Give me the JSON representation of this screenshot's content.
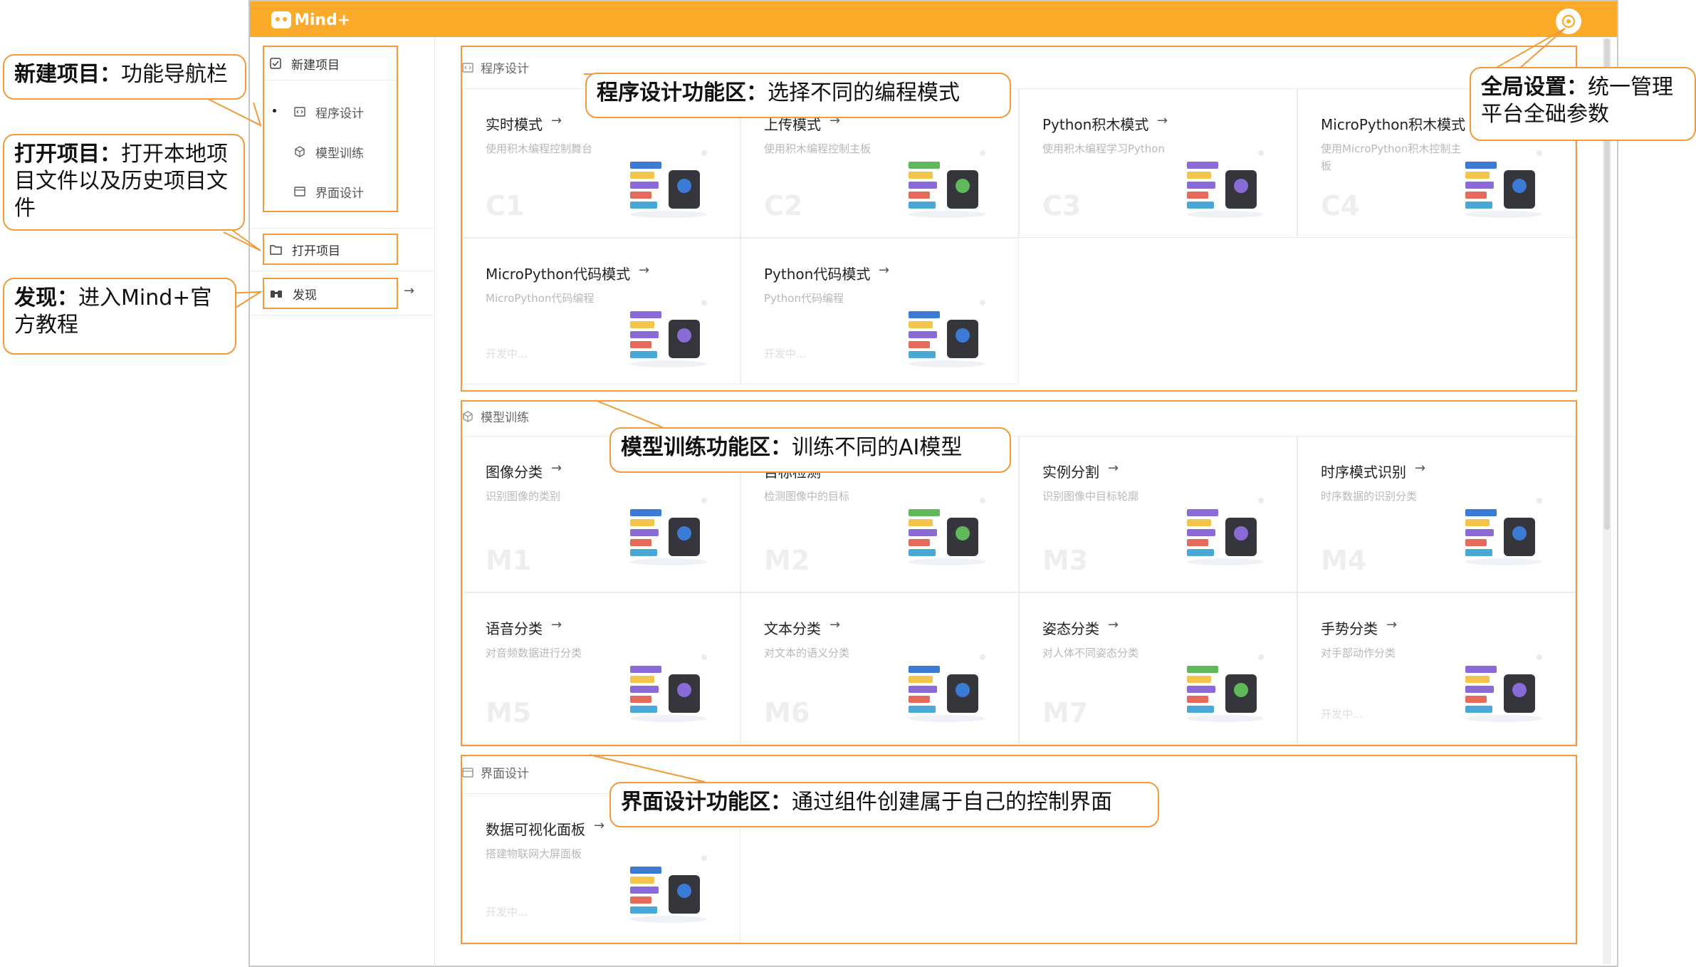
{
  "app": {
    "logo_text": "Mind+"
  },
  "nav": {
    "new_project": "新建项目",
    "sub_items": [
      "程序设计",
      "模型训练",
      "界面设计"
    ],
    "open_project": "打开项目",
    "discover": "发现"
  },
  "sections": {
    "program": {
      "title": "程序设计",
      "cards": [
        {
          "title": "实时模式",
          "desc": "使用积木编程控制舞台",
          "code": "C1"
        },
        {
          "title": "上传模式",
          "desc": "使用积木编程控制主板",
          "code": "C2"
        },
        {
          "title": "Python积木模式",
          "desc": "使用积木编程学习Python",
          "code": "C3"
        },
        {
          "title": "MicroPython积木模式",
          "desc": "使用MicroPython积木控制主板",
          "code": "C4"
        },
        {
          "title": "MicroPython代码模式",
          "desc": "MicroPython代码编程",
          "dev": "开发中..."
        },
        {
          "title": "Python代码模式",
          "desc": "Python代码编程",
          "dev": "开发中..."
        }
      ]
    },
    "model": {
      "title": "模型训练",
      "cards": [
        {
          "title": "图像分类",
          "desc": "识别图像的类别",
          "code": "M1"
        },
        {
          "title": "目标检测",
          "desc": "检测图像中的目标",
          "code": "M2"
        },
        {
          "title": "实例分割",
          "desc": "识别图像中目标轮廓",
          "code": "M3"
        },
        {
          "title": "时序模式识别",
          "desc": "时序数据的识别分类",
          "code": "M4"
        },
        {
          "title": "语音分类",
          "desc": "对音频数据进行分类",
          "code": "M5"
        },
        {
          "title": "文本分类",
          "desc": "对文本的语义分类",
          "code": "M6"
        },
        {
          "title": "姿态分类",
          "desc": "对人体不同姿态分类",
          "code": "M7"
        },
        {
          "title": "手势分类",
          "desc": "对手部动作分类",
          "dev": "开发中..."
        }
      ]
    },
    "ui": {
      "title": "界面设计",
      "cards": [
        {
          "title": "数据可视化面板",
          "desc": "搭建物联网大屏面板",
          "dev": "开发中..."
        }
      ]
    }
  },
  "callouts": {
    "new_project": {
      "bold": "新建项目：",
      "rest": "功能导航栏"
    },
    "open_project": {
      "bold": "打开项目：",
      "rest": "打开本地项目文件以及历史项目文件"
    },
    "discover": {
      "bold": "发现：",
      "rest": "进入Mind+官方教程"
    },
    "program": {
      "bold": "程序设计功能区：",
      "rest": "选择不同的编程模式"
    },
    "settings": {
      "bold": "全局设置：",
      "rest": "统一管理平台全础参数"
    },
    "model": {
      "bold": "模型训练功能区：",
      "rest": "训练不同的AI模型"
    },
    "ui": {
      "bold": "界面设计功能区：",
      "rest": "通过组件创建属于自己的控制界面"
    }
  },
  "colors": {
    "accent": "#fcaa29",
    "callout_border": "#f29a3a"
  }
}
